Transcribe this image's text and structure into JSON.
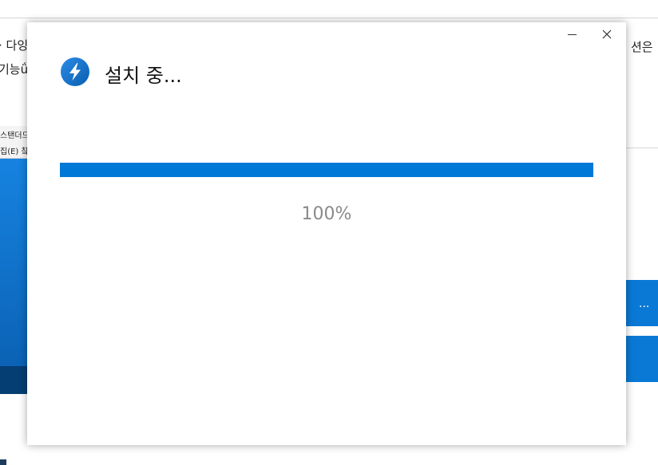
{
  "background": {
    "line1_left": "· 다잉",
    "line1_right": "션은",
    "line2_left": "기능ǘ",
    "thumb_title": "스탠더드",
    "thumb_menu": "집(E)  챀",
    "side_button_label": "..."
  },
  "dialog": {
    "title": "설치 중...",
    "progress": 1.0,
    "percent_label": "100%",
    "accent_color": "#0078d7",
    "icon": "lightning-bolt-icon"
  }
}
